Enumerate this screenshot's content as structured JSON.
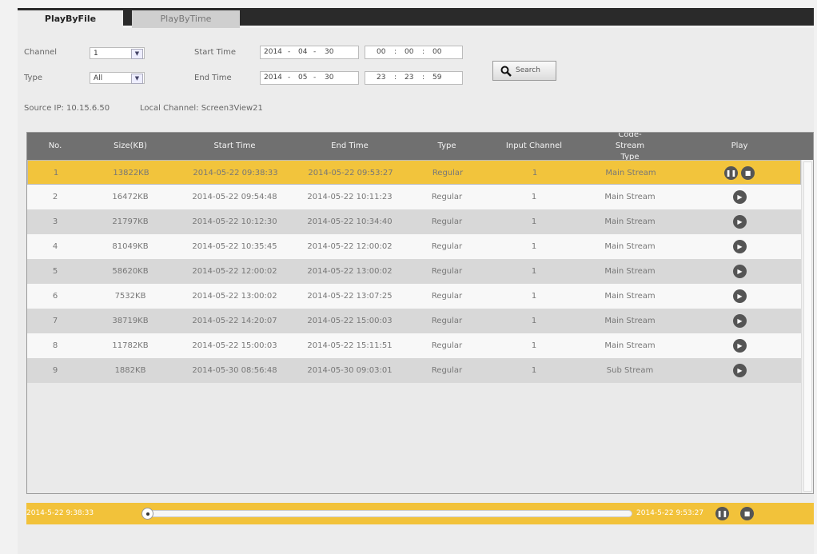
{
  "tabs": [
    {
      "label": "PlayByFile",
      "active": true
    },
    {
      "label": "PlayByTime",
      "active": false
    }
  ],
  "form": {
    "channel_label": "Channel",
    "channel_value": "1",
    "type_label": "Type",
    "type_value": "All",
    "start_label": "Start Time",
    "start_date": {
      "year": "2014",
      "month": "04",
      "day": "30"
    },
    "start_time": {
      "h": "00",
      "m": "00",
      "s": "00"
    },
    "end_label": "End Time",
    "end_date": {
      "year": "2014",
      "month": "05",
      "day": "30"
    },
    "end_time": {
      "h": "23",
      "m": "23",
      "s": "59"
    },
    "search_label": "Search",
    "date_sep": "-",
    "time_sep": ":"
  },
  "info": {
    "source_ip": "Source IP: 10.15.6.50",
    "local_channel": "Local Channel: Screen3View21"
  },
  "table": {
    "headers": [
      "No.",
      "Size(KB)",
      "Start Time",
      "End Time",
      "Type",
      "Input Channel",
      "Code-Stream Type",
      "Play"
    ],
    "rows": [
      [
        "1",
        "13822KB",
        "2014-05-22 09:38:33",
        "2014-05-22 09:53:27",
        "Regular",
        "1",
        "Main Stream"
      ],
      [
        "2",
        "16472KB",
        "2014-05-22 09:54:48",
        "2014-05-22 10:11:23",
        "Regular",
        "1",
        "Main Stream"
      ],
      [
        "3",
        "21797KB",
        "2014-05-22 10:12:30",
        "2014-05-22 10:34:40",
        "Regular",
        "1",
        "Main Stream"
      ],
      [
        "4",
        "81049KB",
        "2014-05-22 10:35:45",
        "2014-05-22 12:00:02",
        "Regular",
        "1",
        "Main Stream"
      ],
      [
        "5",
        "58620KB",
        "2014-05-22 12:00:02",
        "2014-05-22 13:00:02",
        "Regular",
        "1",
        "Main Stream"
      ],
      [
        "6",
        "7532KB",
        "2014-05-22 13:00:02",
        "2014-05-22 13:07:25",
        "Regular",
        "1",
        "Main Stream"
      ],
      [
        "7",
        "38719KB",
        "2014-05-22 14:20:07",
        "2014-05-22 15:00:03",
        "Regular",
        "1",
        "Main Stream"
      ],
      [
        "8",
        "11782KB",
        "2014-05-22 15:00:03",
        "2014-05-22 15:11:51",
        "Regular",
        "1",
        "Main Stream"
      ],
      [
        "9",
        "1882KB",
        "2014-05-30 08:56:48",
        "2014-05-30 09:03:01",
        "Regular",
        "1",
        "Sub Stream"
      ]
    ],
    "selected_row": 0
  },
  "playback": {
    "start": "2014-5-22 9:38:33",
    "end": "2014-5-22 9:53:27",
    "progress": 0
  },
  "icons": {
    "play": "▶",
    "pause": "❚❚",
    "stop": "■",
    "search": "magnifier",
    "dropdown": "chevron-down"
  },
  "colors": {
    "selected": "#f2c43c",
    "header": "#707070",
    "tab_bar": "#2a2a2a"
  }
}
